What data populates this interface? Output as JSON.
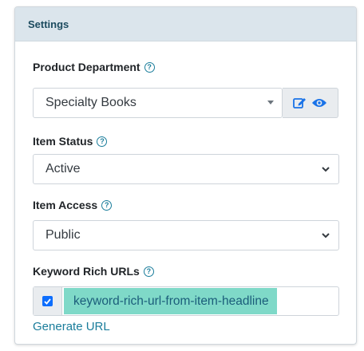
{
  "card": {
    "title": "Settings"
  },
  "product_department": {
    "label": "Product Department",
    "selected": "Specialty Books",
    "help_icon": "question-circle-icon",
    "edit_icon": "edit-icon",
    "view_icon": "eye-icon"
  },
  "item_status": {
    "label": "Item Status",
    "selected": "Active"
  },
  "item_access": {
    "label": "Item Access",
    "selected": "Public"
  },
  "keyword_urls": {
    "label": "Keyword Rich URLs",
    "checked": true,
    "value": "keyword-rich-url-from-item-headline",
    "generate_link": "Generate URL"
  },
  "colors": {
    "accent": "#1a7d9b",
    "header_bg": "#dbe5ec",
    "highlight": "#7fd9c8",
    "checkbox": "#0d6efd"
  }
}
